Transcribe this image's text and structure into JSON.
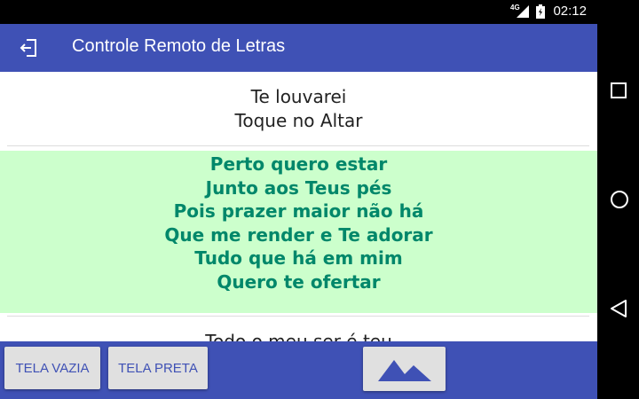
{
  "status_bar": {
    "network": "4G",
    "time": "02:12"
  },
  "app_bar": {
    "title": "Controle Remoto de Letras",
    "back_icon": "exit-icon"
  },
  "lyrics": {
    "previous_lines": [
      "Te louvarei",
      "Toque no Altar"
    ],
    "current_lines": [
      "Perto quero estar",
      "Junto aos Teus pés",
      "Pois prazer maior não há",
      "Que me render e Te adorar",
      "Tudo que há em mim",
      "Quero te ofertar"
    ],
    "next_partial": "Todo o meu ser é teu"
  },
  "bottom_bar": {
    "blank_screen_label": "TELA VAZIA",
    "black_screen_label": "TELA PRETA",
    "image_icon": "mountain-icon"
  },
  "colors": {
    "primary": "#3F51B5",
    "active_bg": "#CCFFCC",
    "active_text": "#00876A"
  }
}
